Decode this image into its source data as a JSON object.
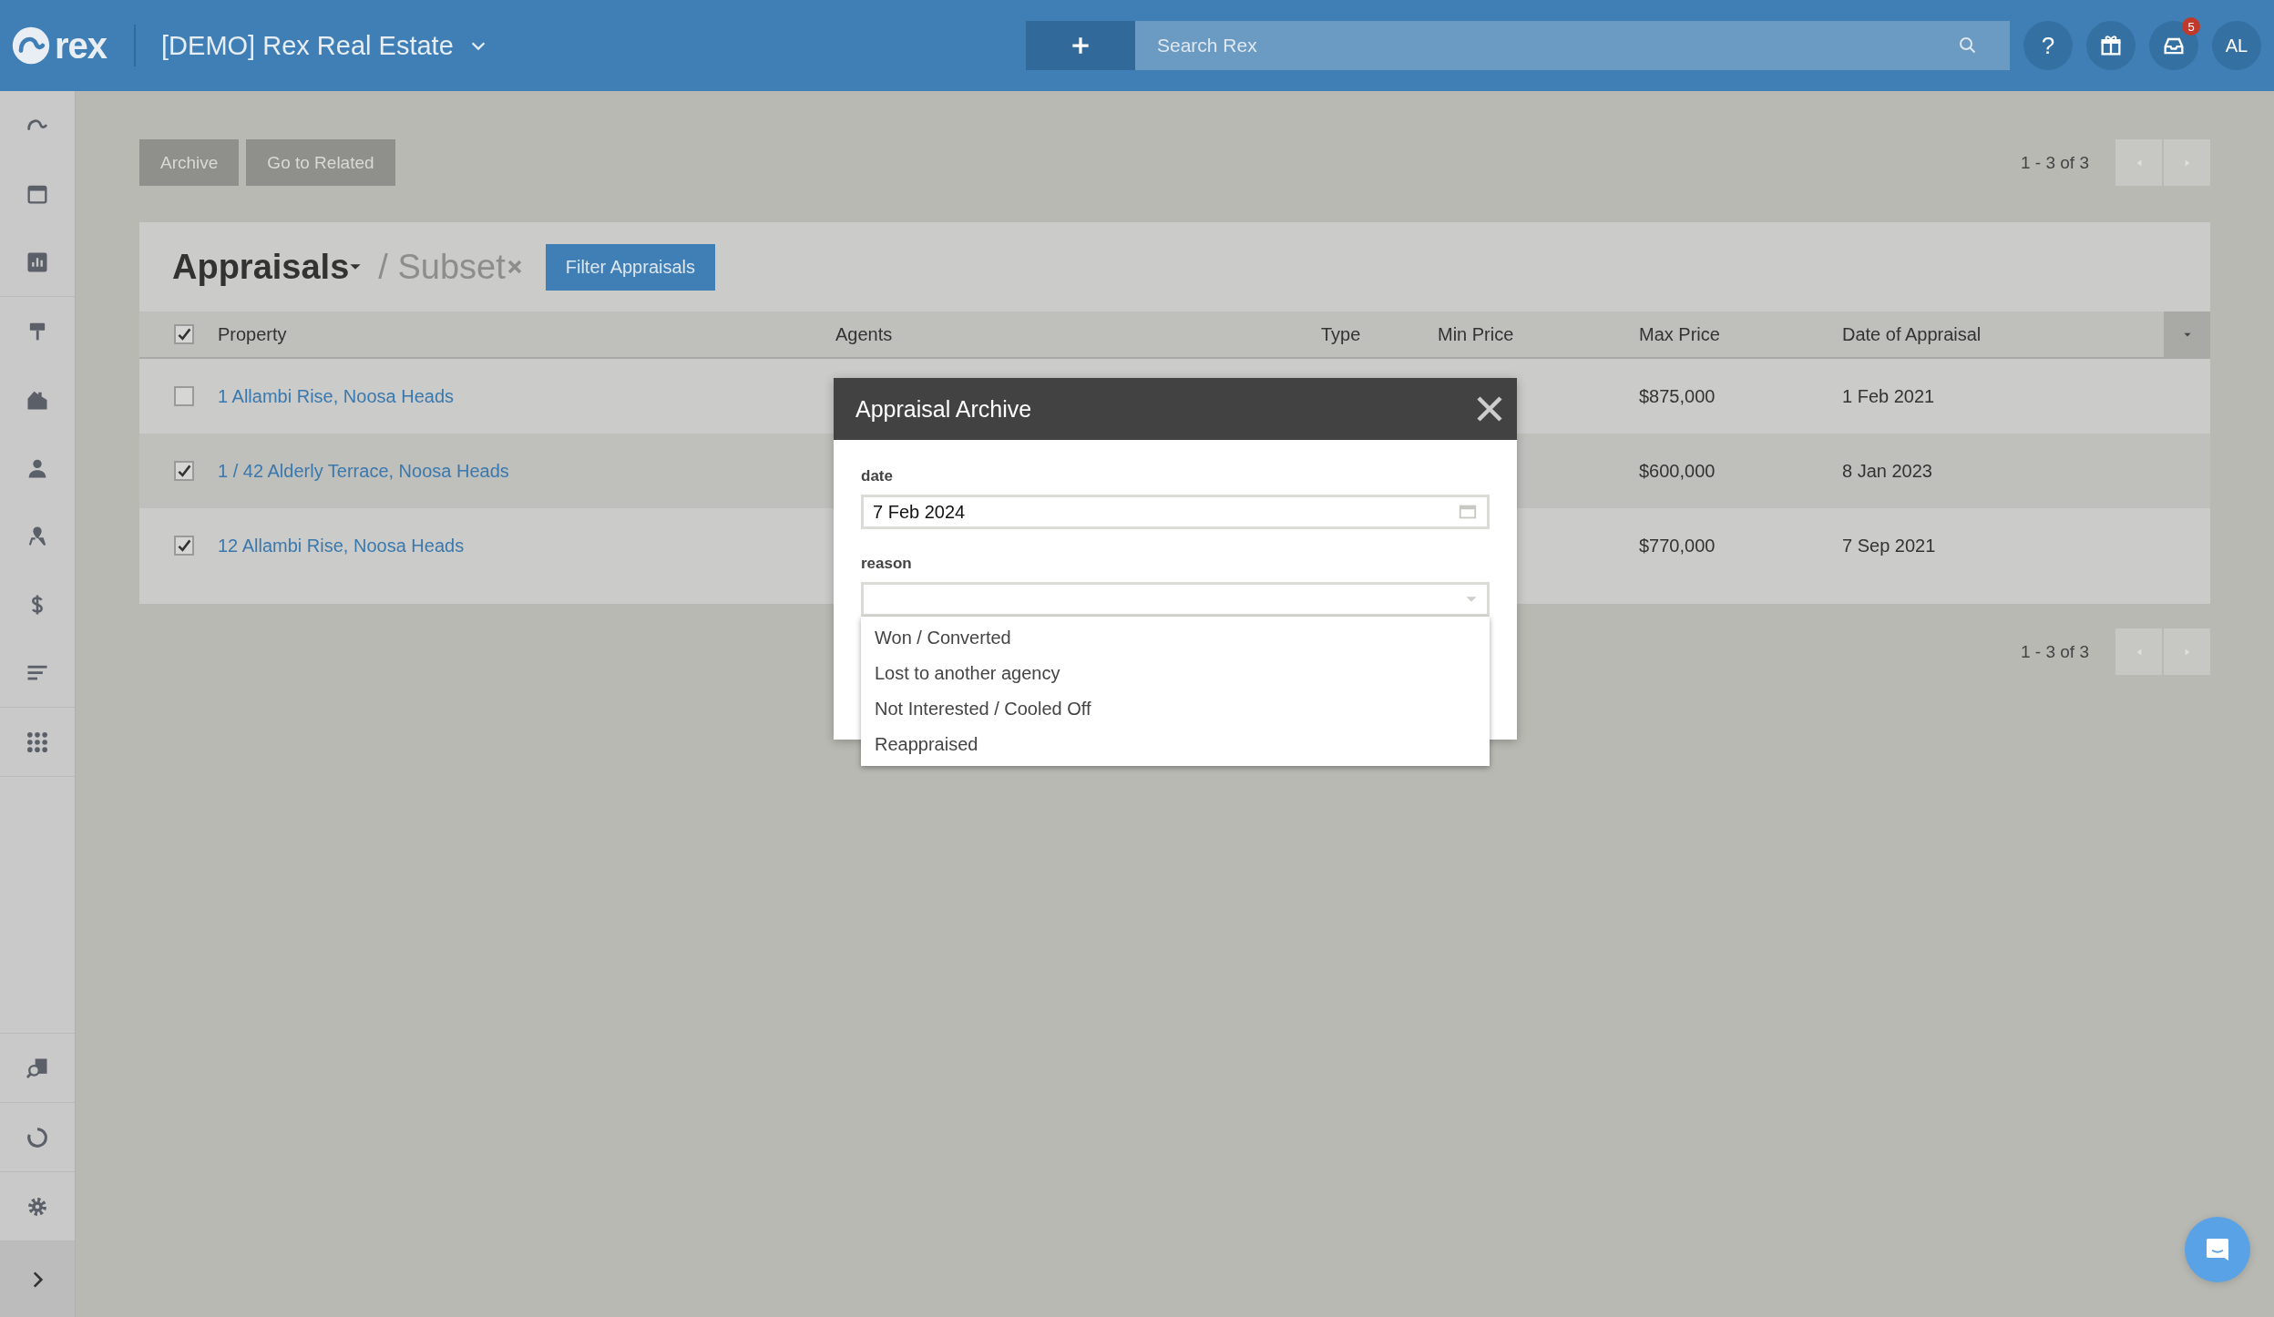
{
  "topbar": {
    "brand": "rex",
    "account": "[DEMO] Rex Real Estate",
    "search": {
      "placeholder": "Search Rex"
    },
    "help": "?",
    "notifications": "5",
    "avatar": "AL"
  },
  "toolbar": {
    "buttons": [
      "Archive",
      "Go to Related"
    ],
    "pagination": "1 - 3 of 3"
  },
  "list": {
    "title": "Appraisals",
    "subset": "/ Subset",
    "filter_button": "Filter Appraisals"
  },
  "table": {
    "select_all_checked": true,
    "columns": [
      "Property",
      "Agents",
      "Type",
      "Min Price",
      "Max Price",
      "Date of Appraisal"
    ],
    "rows": [
      {
        "checked": false,
        "property": "1 Allambi Rise, Noosa Heads",
        "max_price": "$875,000",
        "date": "1 Feb 2021"
      },
      {
        "checked": true,
        "property": "1 / 42 Alderly Terrace, Noosa Heads",
        "max_price": "$600,000",
        "date": "8 Jan 2023"
      },
      {
        "checked": true,
        "property": "12 Allambi Rise, Noosa Heads",
        "max_price": "$770,000",
        "date": "7 Sep 2021"
      }
    ]
  },
  "footer_pagination": "1 - 3 of 3",
  "modal": {
    "title": "Appraisal Archive",
    "fields": [
      {
        "kind": "date",
        "label": "date",
        "value": "7 Feb 2024"
      },
      {
        "kind": "select",
        "label": "reason",
        "expanded": true,
        "options": [
          "Won / Converted",
          "Lost to another agency",
          "Not Interested / Cooled Off",
          "Reappraised"
        ]
      }
    ]
  }
}
